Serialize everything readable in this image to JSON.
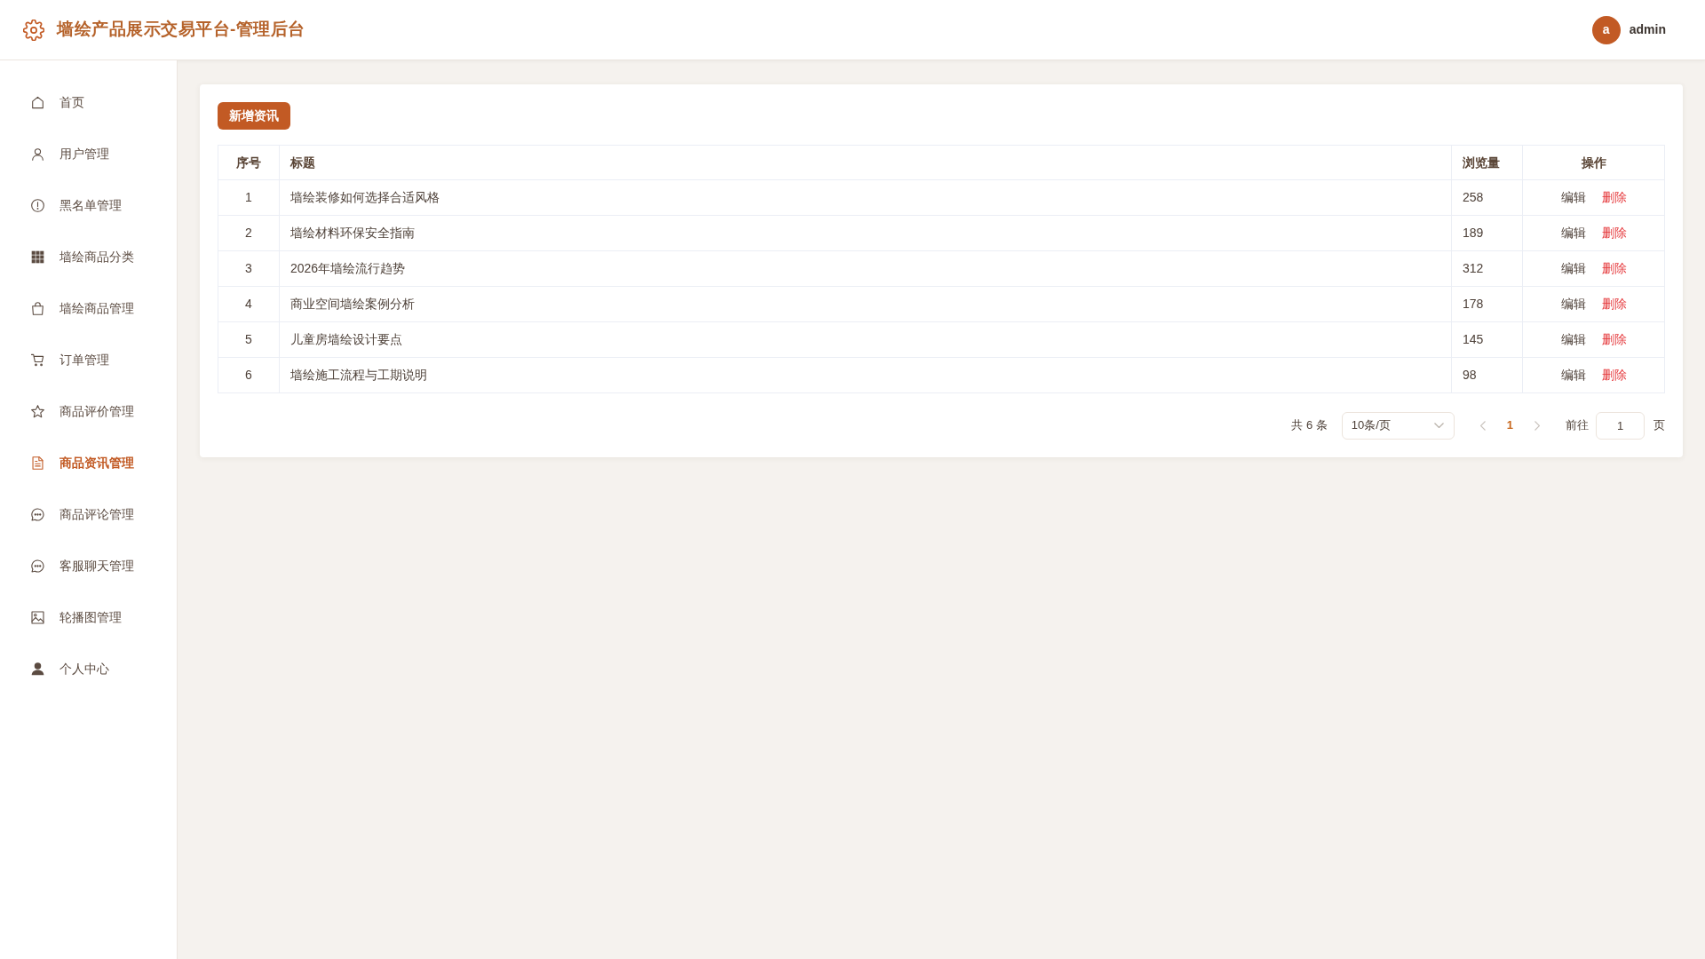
{
  "header": {
    "title": "墙绘产品展示交易平台-管理后台",
    "user": {
      "avatar": "a",
      "name": "admin"
    }
  },
  "sidebar": {
    "items": [
      {
        "label": "首页",
        "selected": false
      },
      {
        "label": "用户管理",
        "selected": false
      },
      {
        "label": "黑名单管理",
        "selected": false
      },
      {
        "label": "墙绘商品分类",
        "selected": false
      },
      {
        "label": "墙绘商品管理",
        "selected": false
      },
      {
        "label": "订单管理",
        "selected": false
      },
      {
        "label": "商品评价管理",
        "selected": false
      },
      {
        "label": "商品资讯管理",
        "selected": true
      },
      {
        "label": "商品评论管理",
        "selected": false
      },
      {
        "label": "客服聊天管理",
        "selected": false
      },
      {
        "label": "轮播图管理",
        "selected": false
      },
      {
        "label": "个人中心",
        "selected": false
      }
    ]
  },
  "content": {
    "add_button": "新增资讯",
    "table": {
      "columns": [
        "序号",
        "标题",
        "浏览量",
        "操作"
      ],
      "rows": [
        {
          "no": "1",
          "title": "墙绘装修如何选择合适风格",
          "views": "258",
          "actions": [
            {
              "kind": "edit",
              "label": "编辑"
            },
            {
              "kind": "delete",
              "label": "删除"
            }
          ]
        },
        {
          "no": "2",
          "title": "墙绘材料环保安全指南",
          "views": "189",
          "actions": [
            {
              "kind": "edit",
              "label": "编辑"
            },
            {
              "kind": "delete",
              "label": "删除"
            }
          ]
        },
        {
          "no": "3",
          "title": "2026年墙绘流行趋势",
          "views": "312",
          "actions": [
            {
              "kind": "edit",
              "label": "编辑"
            },
            {
              "kind": "delete",
              "label": "删除"
            }
          ]
        },
        {
          "no": "4",
          "title": "商业空间墙绘案例分析",
          "views": "178",
          "actions": [
            {
              "kind": "edit",
              "label": "编辑"
            },
            {
              "kind": "delete",
              "label": "删除"
            }
          ]
        },
        {
          "no": "5",
          "title": "儿童房墙绘设计要点",
          "views": "145",
          "actions": [
            {
              "kind": "edit",
              "label": "编辑"
            },
            {
              "kind": "delete",
              "label": "删除"
            }
          ]
        },
        {
          "no": "6",
          "title": "墙绘施工流程与工期说明",
          "views": "98",
          "actions": [
            {
              "kind": "edit",
              "label": "编辑"
            },
            {
              "kind": "delete",
              "label": "删除"
            }
          ]
        }
      ]
    },
    "pagination": {
      "total": "共 6 条",
      "page_size": "10条/页",
      "prev": {
        "disabled": true
      },
      "pages": [
        {
          "label": "1",
          "selected": true
        }
      ],
      "next": {
        "disabled": true
      },
      "goto_label": "前往",
      "goto_value": "1",
      "page_suffix": "页"
    }
  }
}
